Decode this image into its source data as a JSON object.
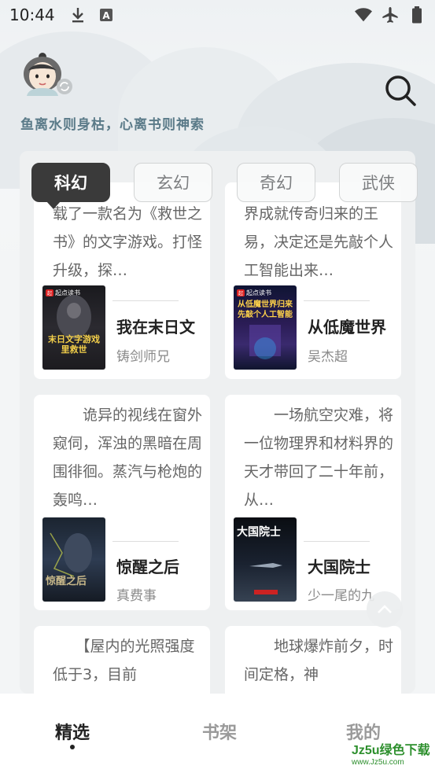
{
  "status_bar": {
    "time": "10:44",
    "icons_left": [
      "download-icon",
      "text-a-icon"
    ],
    "icons_right": [
      "wifi-icon",
      "airplane-icon",
      "battery-icon"
    ]
  },
  "header": {
    "slogan": "鱼离水则身枯，心离书则神索",
    "search_icon": "search-icon"
  },
  "tabs": [
    {
      "label": "科幻",
      "active": true
    },
    {
      "label": "玄幻",
      "active": false
    },
    {
      "label": "奇幻",
      "active": false
    },
    {
      "label": "武侠",
      "active": false
    }
  ],
  "books": [
    {
      "desc": "载了一款名为《救世之书》的文字游戏。打怪升级，探…",
      "title": "我在末日文",
      "author": "铸剑师兄",
      "cover_text": "末日文字游戏 里救世"
    },
    {
      "desc": "界成就传奇归来的王易，决定还是先敲个人工智能出来…",
      "title": "从低魔世界",
      "author": "吴杰超",
      "cover_text": "从低魔世界归来 先敲个人工智能"
    },
    {
      "desc": "　　诡异的视线在窗外窥伺，浑浊的黑暗在周围徘徊。蒸汽与枪炮的轰鸣…",
      "title": "惊醒之后",
      "author": "真费事",
      "cover_text": "惊醒之后"
    },
    {
      "desc": "　　一场航空灾难，将一位物理界和材料界的天才带回了二十年前，从…",
      "title": "大国院士",
      "author": "少一尾的九",
      "cover_text": "大国院士"
    },
    {
      "desc": "　　【屋内的光照强度低于3，目前",
      "title": "",
      "author": "",
      "cover_text": ""
    },
    {
      "desc": "　　地球爆炸前夕，时间定格，神",
      "title": "",
      "author": "",
      "cover_text": ""
    }
  ],
  "cover_brand": "起点读书",
  "bottom_nav": [
    {
      "label": "精选",
      "active": true
    },
    {
      "label": "书架",
      "active": false
    },
    {
      "label": "我的",
      "active": false
    }
  ],
  "watermark": {
    "line1": "Jz5u绿色下载",
    "line2": "www.Jz5u.com"
  }
}
